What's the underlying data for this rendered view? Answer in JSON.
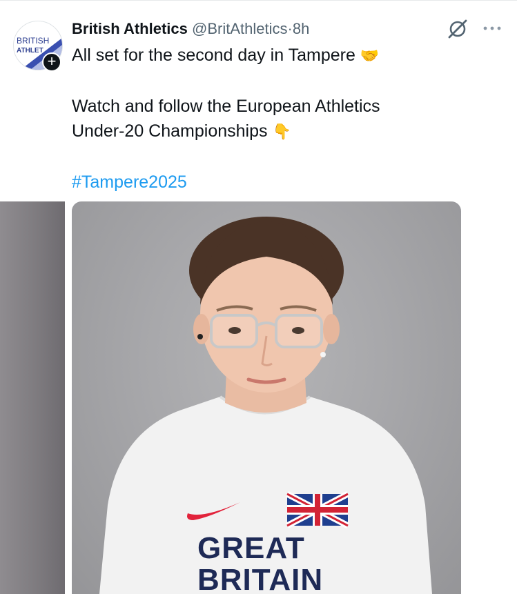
{
  "tweet": {
    "author": {
      "display_name": "British Athletics",
      "handle": "@BritAthletics",
      "separator": "·",
      "time": "8h",
      "avatar_text_line1": "BRITISH",
      "avatar_text_line2": "ATHLET"
    },
    "text": {
      "line1": "All set for the second day in Tampere",
      "line1_emoji": "🤝",
      "line2": "Watch and follow the European Athletics",
      "line3": "Under-20 Championships",
      "line3_emoji": "👇",
      "hashtag": "#Tampere2025"
    },
    "icons": {
      "follow": "+",
      "grok": "grok-icon",
      "more": "more-icon"
    },
    "media": {
      "shirt_line1": "GREAT",
      "shirt_line2": "BRITAIN"
    }
  },
  "colors": {
    "link": "#1d9bf0",
    "secondary_text": "#536471",
    "primary_text": "#0f1419",
    "logo_blue": "#2b3d8f",
    "swoosh_red": "#e2233b"
  }
}
